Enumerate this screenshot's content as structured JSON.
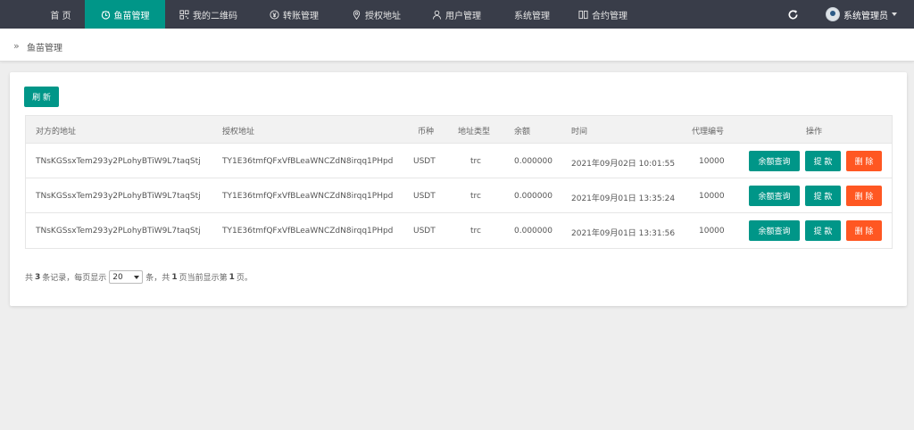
{
  "nav": {
    "items": [
      {
        "label": "首 页",
        "icon": null
      },
      {
        "label": "鱼苗管理",
        "icon": "timer-icon"
      },
      {
        "label": "我的二维码",
        "icon": "qrcode-icon"
      },
      {
        "label": "转账管理",
        "icon": "yen-icon"
      },
      {
        "label": "授权地址",
        "icon": "location-pin-icon"
      },
      {
        "label": "用户管理",
        "icon": "user-icon"
      },
      {
        "label": "系统管理",
        "icon": null
      },
      {
        "label": "合约管理",
        "icon": "contract-icon"
      }
    ],
    "active_index": 1,
    "refresh_icon": "refresh-icon",
    "user_label": "系统管理员"
  },
  "breadcrumb": {
    "icon": "double-chevron-right-icon",
    "text": "鱼苗管理"
  },
  "toolbar": {
    "refresh_label": "刷 新"
  },
  "table": {
    "headers": [
      "对方的地址",
      "授权地址",
      "币种",
      "地址类型",
      "余额",
      "时间",
      "代理编号",
      "操作"
    ],
    "rows": [
      {
        "address": "TNsKGSsxTem293y2PLohyBTiW9L7taqStj",
        "auth_address": "TY1E36tmfQFxVfBLeaWNCZdN8irqq1PHpd",
        "currency": "USDT",
        "addr_type": "trc",
        "balance": "0.000000",
        "time": "2021年09月02日 10:01:55",
        "agent": "10000"
      },
      {
        "address": "TNsKGSsxTem293y2PLohyBTiW9L7taqStj",
        "auth_address": "TY1E36tmfQFxVfBLeaWNCZdN8irqq1PHpd",
        "currency": "USDT",
        "addr_type": "trc",
        "balance": "0.000000",
        "time": "2021年09月01日 13:35:24",
        "agent": "10000"
      },
      {
        "address": "TNsKGSsxTem293y2PLohyBTiW9L7taqStj",
        "auth_address": "TY1E36tmfQFxVfBLeaWNCZdN8irqq1PHpd",
        "currency": "USDT",
        "addr_type": "trc",
        "balance": "0.000000",
        "time": "2021年09月01日 13:31:56",
        "agent": "10000"
      }
    ],
    "actions": {
      "balance_query": "余额查询",
      "withdraw": "提 款",
      "delete": "删 除"
    }
  },
  "pager": {
    "prefix": "共",
    "total_records": "3",
    "records_suffix": "条记录，每页显示",
    "page_size": "20",
    "page_size_suffix": "条，共",
    "total_pages": "1",
    "pages_text": "页当前显示第",
    "current_page": "1",
    "end": "页。"
  },
  "colors": {
    "nav_bg": "#393d49",
    "accent": "#009688",
    "danger": "#ff5722",
    "page_bg": "#eeeeee"
  }
}
